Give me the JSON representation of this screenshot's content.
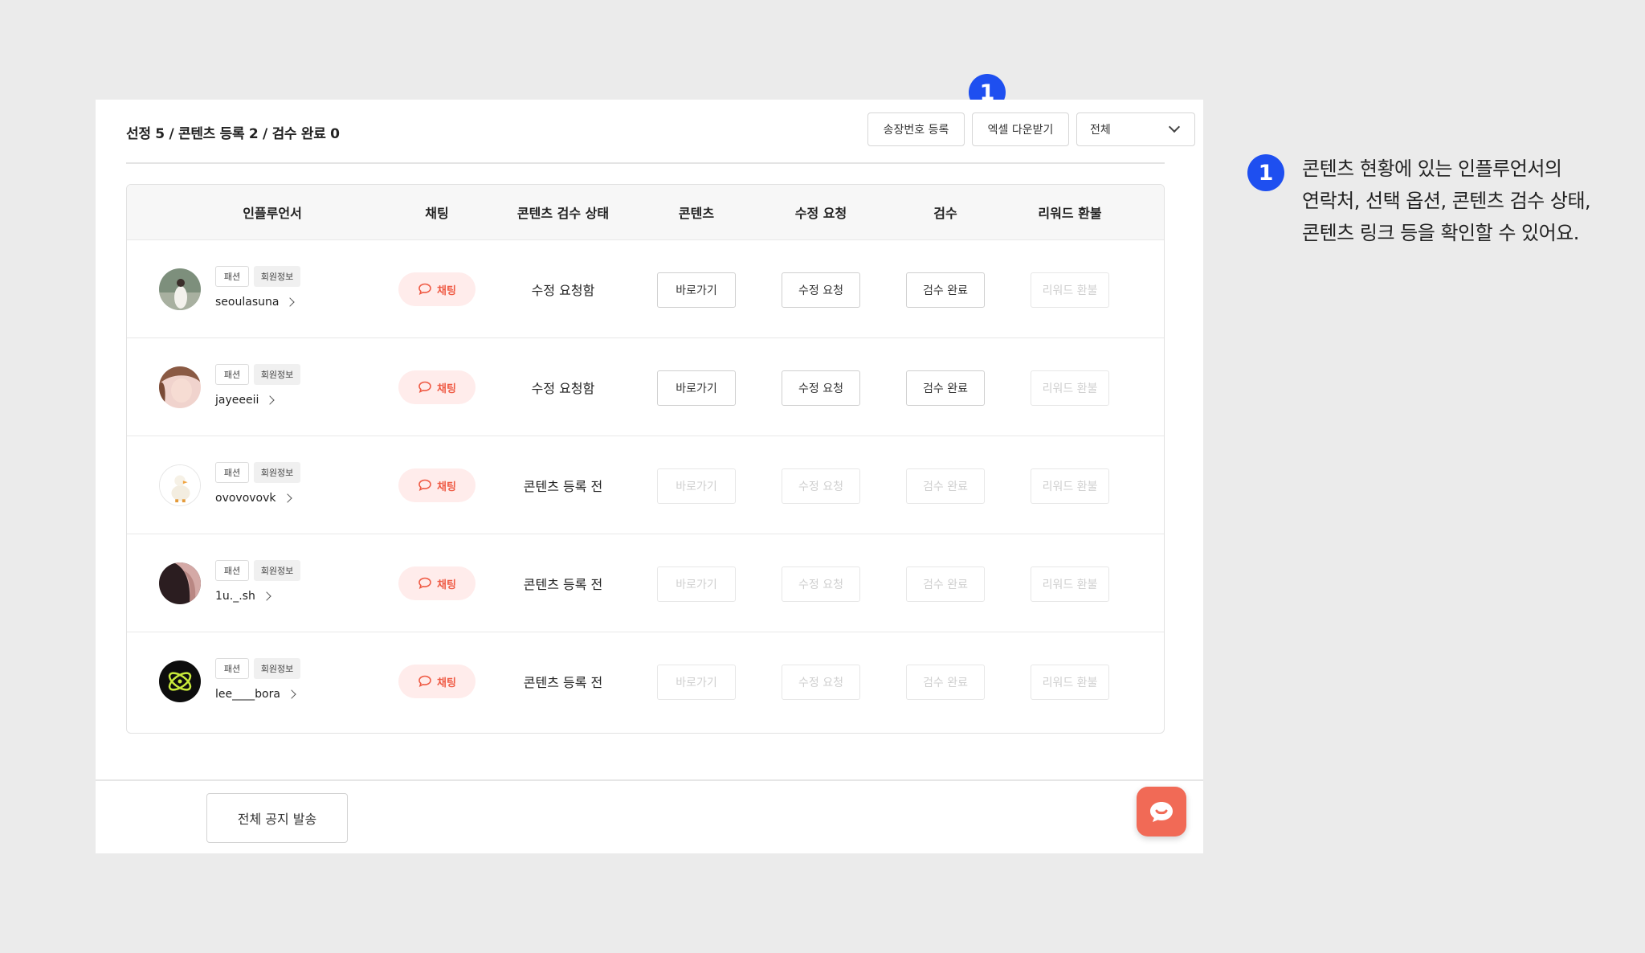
{
  "summary": "선정 5 / 콘텐츠 등록 2 / 검수 완료 0",
  "toolbar": {
    "shipping_label": "송장번호 등록",
    "excel_label": "엑셀 다운받기",
    "filter_value": "전체"
  },
  "columns": {
    "influencer": "인플루언서",
    "chat": "채팅",
    "status": "콘텐츠 검수 상태",
    "content": "콘텐츠",
    "revision": "수정 요청",
    "review": "검수",
    "refund": "리워드 환불"
  },
  "rows": [
    {
      "username": "seoulasuna",
      "category": "패션",
      "info": "회원정보",
      "chat": "채팅",
      "status": "수정 요청함",
      "go": "바로가기",
      "revision": "수정 요청",
      "review": "검수 완료",
      "refund": "리워드 환불",
      "avatar_color": "#8a9a8a"
    },
    {
      "username": "jayeeeii",
      "category": "패션",
      "info": "회원정보",
      "chat": "채팅",
      "status": "수정 요청함",
      "go": "바로가기",
      "revision": "수정 요청",
      "review": "검수 완료",
      "refund": "리워드 환불",
      "avatar_color": "#e8b7b2"
    },
    {
      "username": "ovovovovk",
      "category": "패션",
      "info": "회원정보",
      "chat": "채팅",
      "status": "콘텐츠 등록 전",
      "go": "바로가기",
      "revision": "수정 요청",
      "review": "검수 완료",
      "refund": "리워드 환불",
      "avatar_color": "#f2efe6"
    },
    {
      "username": "1u._.sh",
      "category": "패션",
      "info": "회원정보",
      "chat": "채팅",
      "status": "콘텐츠 등록 전",
      "go": "바로가기",
      "revision": "수정 요청",
      "review": "검수 완료",
      "refund": "리워드 환불",
      "avatar_color": "#4a3236"
    },
    {
      "username": "lee____bora",
      "category": "패션",
      "info": "회원정보",
      "chat": "채팅",
      "status": "콘텐츠 등록 전",
      "go": "바로가기",
      "revision": "수정 요청",
      "review": "검수 완료",
      "refund": "리워드 환불",
      "avatar_color": "#111111"
    }
  ],
  "footer": {
    "notice_label": "전체 공지 발송"
  },
  "annotation": {
    "number": "1",
    "lines": [
      "콘텐츠 현황에 있는 인플루언서의",
      "연락처, 선택 옵션, 콘텐츠 검수 상태,",
      "콘텐츠 링크 등을 확인할 수 있어요."
    ]
  },
  "colors": {
    "accent_blue": "#1e4ff0",
    "chat_red": "#ef5b45",
    "fab": "#f16a56"
  },
  "icons": [
    "chat-bubble-icon",
    "chevron-right-icon",
    "chevron-down-icon",
    "chat-fab-icon"
  ]
}
